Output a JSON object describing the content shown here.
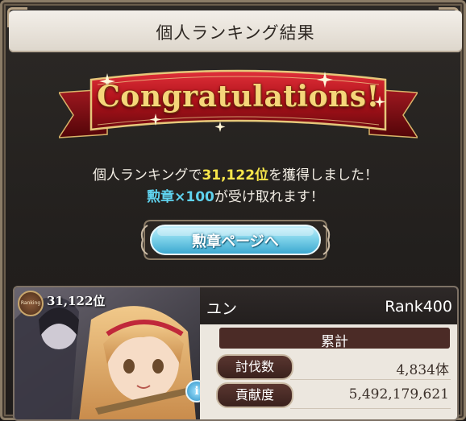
{
  "header": {
    "title": "個人ランキング結果"
  },
  "banner": {
    "text": "Congratulations!"
  },
  "message": {
    "line1_prefix": "個人ランキングで",
    "line1_rank": "31,122位",
    "line1_suffix": "を獲得しました！",
    "line2_reward": "勲章×100",
    "line2_suffix": "が受け取れます！"
  },
  "medal_button": {
    "label": "勲章ページへ"
  },
  "player_card": {
    "rank_badge": "Ranking",
    "rank_position": "31,122位",
    "name": "ユン",
    "rank": "Rank400",
    "total_label": "累計",
    "stats": [
      {
        "label": "討伐数",
        "value": "4,834体"
      },
      {
        "label": "貢献度",
        "value": "5,492,179,621"
      }
    ],
    "info_icon": "info-icon"
  },
  "colors": {
    "highlight_yellow": "#f7e64a",
    "highlight_cyan": "#5fd2ee",
    "banner_red": "#b0121a",
    "button_cyan": "#7fd3ea"
  }
}
